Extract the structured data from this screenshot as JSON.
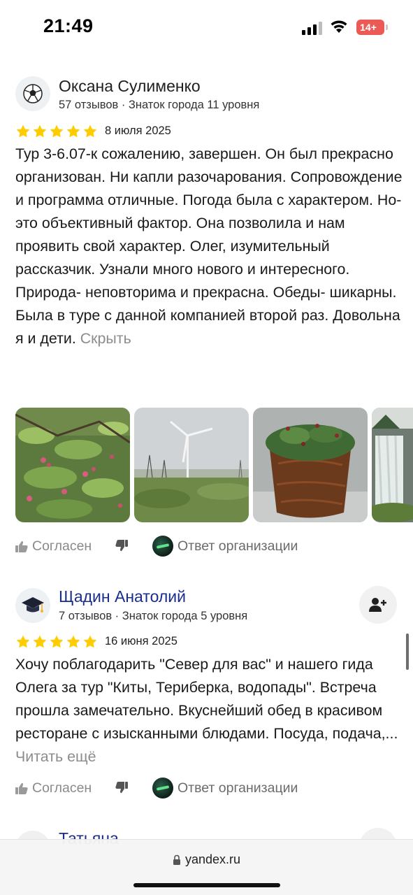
{
  "status_bar": {
    "time": "21:49",
    "battery": "14+"
  },
  "reviews": [
    {
      "author": "Оксана Сулименко",
      "meta": "57 отзывов · Знаток города 11 уровня",
      "avatar_icon": "soccer-ball-icon",
      "rating": 5,
      "date": "8 июля 2025",
      "text": "Тур 3-6.07-к сожалению, завершен. Он был прекрасно организован. Ни капли разочарования. Сопровождение и программа отличные. Погода была с характером. Но- это объективный фактор. Она позволила и нам проявить свой характер. Олег, изумительный рассказчик. Узнали много нового и интересного. Природа- неповторима и прекрасна. Обеды- шикарны. Была в туре с данной компанией второй раз. Довольна я и дети.",
      "toggle_label": "Скрыть",
      "photos": [
        "berry-bushes-photo",
        "wind-turbine-photo",
        "moss-pot-photo",
        "waterfall-photo"
      ],
      "like_label": "Согласен",
      "org_reply_label": "Ответ организации"
    },
    {
      "author": "Щадин Анатолий",
      "meta": "7 отзывов · Знаток города 5 уровня",
      "avatar_icon": "graduation-cap-icon",
      "rating": 5,
      "date": "16 июня 2025",
      "text": "Хочу поблагодарить \"Север для вас\" и нашего гида Олега за тур \"Киты, Териберка, водопады\". Встреча прошла замечательно. Вкуснейший обед в красивом ресторане с изысканными блюдами. Посуда, подача,...",
      "toggle_label": "Читать ещё",
      "like_label": "Согласен",
      "org_reply_label": "Ответ организации"
    },
    {
      "author": "Татьяна"
    }
  ],
  "browser": {
    "url": "yandex.ru"
  },
  "colors": {
    "star": "#ffcc00",
    "author_link": "#1a2d8f",
    "muted": "#8c8c8c",
    "battery_low": "#ec5a55"
  }
}
